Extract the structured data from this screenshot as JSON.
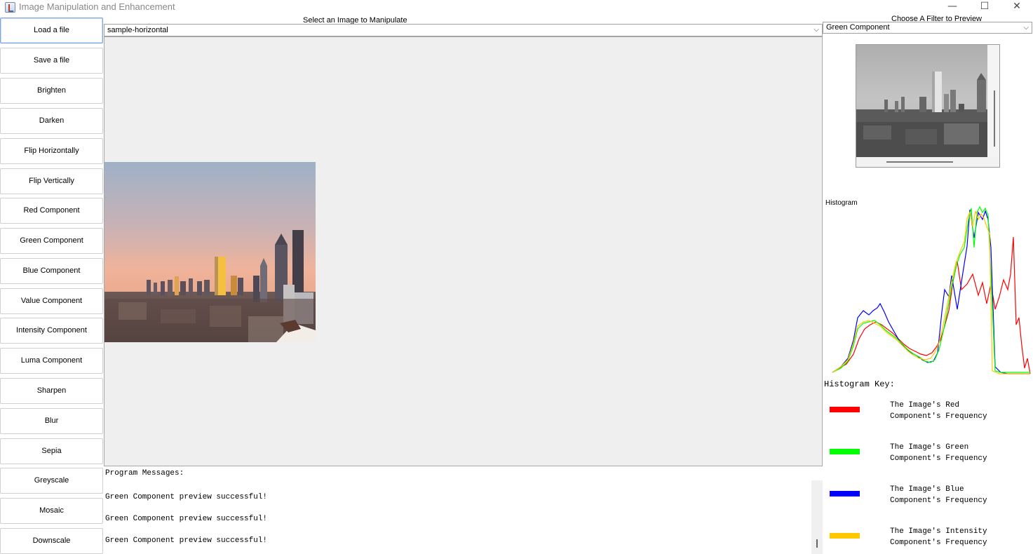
{
  "window": {
    "title": "Image Manipulation and Enhancement",
    "min_glyph": "—",
    "max_glyph": "☐",
    "close_glyph": "✕"
  },
  "left_panel": {
    "buttons": [
      "Load a file",
      "Save a file",
      "Brighten",
      "Darken",
      "Flip Horizontally",
      "Flip Vertically",
      "Red Component",
      "Green Component",
      "Blue Component",
      "Value Component",
      "Intensity Component",
      "Luma Component",
      "Sharpen",
      "Blur",
      "Sepia",
      "Greyscale",
      "Mosaic",
      "Downscale"
    ]
  },
  "center": {
    "label": "Select an Image to Manipulate",
    "selected_image": "sample-horizontal"
  },
  "messages": {
    "title": "Program Messages:",
    "items": [
      "Green Component preview successful!",
      "Green Component preview successful!",
      "Green Component preview successful!"
    ]
  },
  "right_panel": {
    "filter_label": "Choose A Filter to Preview",
    "selected_filter": "Green Component",
    "histogram_label": "Histogram",
    "key_title": "Histogram Key:",
    "key_items": [
      {
        "line1": "The Image's Red",
        "line2": "Component's Frequency",
        "color": "#ff0000"
      },
      {
        "line1": "The Image's Green",
        "line2": "Component's Frequency",
        "color": "#00ff00"
      },
      {
        "line1": "The Image's Blue",
        "line2": "Component's Frequency",
        "color": "#0000ff"
      },
      {
        "line1": "The Image's Intensity",
        "line2": "Component's Frequency",
        "color": "#ffc800"
      }
    ]
  },
  "colors": {
    "red": "#ff0000",
    "green": "#00ff00",
    "blue": "#0000ff",
    "intensity": "#ffc800"
  }
}
